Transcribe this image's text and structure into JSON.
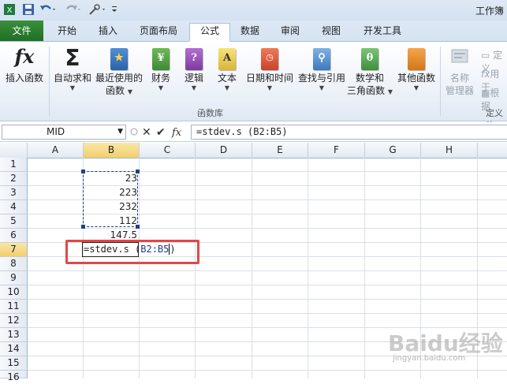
{
  "window": {
    "title": "工作簿"
  },
  "tabs": [
    "文件",
    "开始",
    "插入",
    "页面布局",
    "公式",
    "数据",
    "审阅",
    "视图",
    "开发工具"
  ],
  "ribbon": {
    "insert_function": "插入函数",
    "autosum": "自动求和",
    "recent": [
      "最近使用的",
      "函数"
    ],
    "financial": "财务",
    "logical": "逻辑",
    "text": "文本",
    "datetime": "日期和时间",
    "lookup": "查找与引用",
    "math": [
      "数学和",
      "三角函数"
    ],
    "other": "其他函数",
    "name_manager": [
      "名称",
      "管理器"
    ],
    "define_name": "定义",
    "use_in_formula": "用于",
    "create_from_sel": "根据",
    "group_library": "函数库",
    "group_defined": "定义的"
  },
  "formula_bar": {
    "name_box": "MID",
    "formula": "=stdev.s (B2:B5)"
  },
  "grid": {
    "columns": [
      "A",
      "B",
      "C",
      "D",
      "E",
      "F",
      "G",
      "H"
    ],
    "rows": [
      "1",
      "2",
      "3",
      "4",
      "5",
      "6",
      "7",
      "8",
      "9",
      "10",
      "11",
      "12",
      "13",
      "14",
      "15",
      "16"
    ],
    "b_values": [
      "23",
      "223",
      "232",
      "112"
    ],
    "b6": "147.5",
    "active_text": "=stdev.s (",
    "active_ref": "B2:B5",
    "active_close": ")"
  },
  "watermark": {
    "brand": "Baidu经验",
    "url": "jingyan.baidu.com"
  }
}
